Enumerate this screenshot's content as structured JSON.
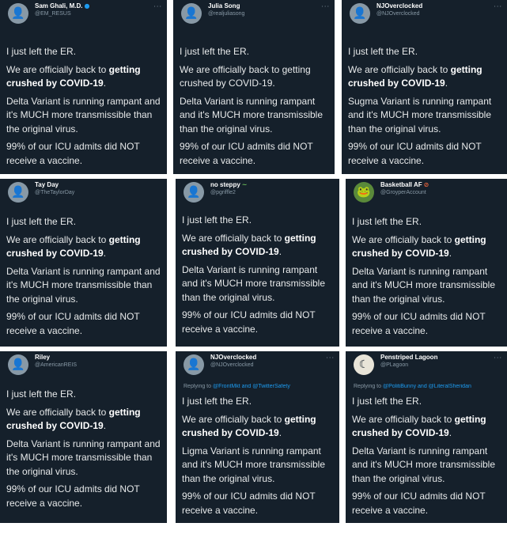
{
  "tweets": [
    {
      "name": "Sam Ghali, M.D.",
      "handle": "@EM_RESUS",
      "badge": "verified-icon",
      "avatar_glyph": "👤",
      "line1": "I just left the ER.",
      "line2_pre": "We are officially back to ",
      "line2_bold1": "getting",
      "line2_bold2": "crushed by COVID-19",
      "line3": "Delta Variant is running rampant and it's MUCH more transmissible than the original virus.",
      "line4": "99% of our ICU admits did NOT receive a vaccine."
    },
    {
      "name": "Julia Song",
      "handle": "@realjuliasong",
      "badge": "",
      "avatar_glyph": "👤",
      "line1": "I just left the ER.",
      "line2_pre": "We are officially back to getting crushed by COVID-19.",
      "line2_bold1": "",
      "line2_bold2": "",
      "line3": "Delta Variant is running rampant and it's MUCH more transmissible than the original virus.",
      "line4": "99% of our ICU admits did NOT receive a vaccine."
    },
    {
      "name": "NJOverclocked",
      "handle": "@NJOverclocked",
      "badge": "",
      "avatar_glyph": "👤",
      "line1": "I just left the ER.",
      "line2_pre": "We are officially back to ",
      "line2_bold1": "getting",
      "line2_bold2": "crushed by COVID-19",
      "line3": "Sugma Variant is running rampant and it's MUCH more transmissible than the original virus.",
      "line4": "99% of our ICU admits did NOT receive a vaccine."
    },
    {
      "name": "Tay Day",
      "handle": "@TheTaylorDay",
      "badge": "",
      "avatar_glyph": "👤",
      "line1": "I just left the ER.",
      "line2_pre": "We are officially back to ",
      "line2_bold1": "getting",
      "line2_bold2": "crushed by COVID-19",
      "line3": "Delta Variant is running rampant and it's MUCH more transmissible than the original virus.",
      "line4": "99% of our ICU admits did NOT receive a vaccine."
    },
    {
      "name": "no steppy",
      "handle": "@pgriffle2",
      "badge": "snake-emoji-icon",
      "avatar_glyph": "👤",
      "line1": "I just left the ER.",
      "line2_pre": "We are officially back to ",
      "line2_bold1": "getting",
      "line2_bold2": "crushed by COVID-19",
      "line3": "Delta Variant is running rampant and it's MUCH more transmissible than the original virus.",
      "line4": "99% of our ICU admits did NOT receive a vaccine."
    },
    {
      "name": "Basketball AF",
      "handle": "@GroyperAccount",
      "badge": "no-entry-icon",
      "avatar_glyph": "🐸",
      "line1": "I just left the ER.",
      "line2_pre": "We are officially back to ",
      "line2_bold1": "getting",
      "line2_bold2": "crushed by COVID-19",
      "line3": "Delta Variant is running rampant and it's MUCH more transmissible than the original virus.",
      "line4": "99% of our ICU admits did NOT receive a vaccine."
    },
    {
      "name": "Riley",
      "handle": "@AmericanREIS",
      "badge": "",
      "avatar_glyph": "👤",
      "line1": "I just left the ER.",
      "line2_pre": "We are officially back to ",
      "line2_bold1": "getting",
      "line2_bold2": "crushed by COVID-19",
      "line3": "Delta Variant is running rampant and it's MUCH more transmissible than the original virus.",
      "line4": "99% of our ICU admits did NOT receive a vaccine."
    },
    {
      "name": "NJOverclocked",
      "handle": "@NJOverclocked",
      "badge": "",
      "avatar_glyph": "👤",
      "replying": "Replying to ",
      "mentions": "@FrontMkt and @TwitterSafety",
      "line1": "I just left the ER.",
      "line2_pre": "We are officially back to ",
      "line2_bold1": "getting",
      "line2_bold2": "crushed by COVID-19",
      "line3": "Ligma Variant is running rampant and it's MUCH more transmissible than the original virus.",
      "line4": "99% of our ICU admits did NOT receive a vaccine."
    },
    {
      "name": "Penstriped Lagoon",
      "handle": "@PLagoon",
      "badge": "",
      "avatar_glyph": "☾",
      "replying": "Replying to ",
      "mentions": "@PolitiBunny and @LiteralSheridan",
      "line1": "I just left the ER.",
      "line2_pre": "We are officially back to ",
      "line2_bold1": "getting",
      "line2_bold2": "crushed by COVID-19",
      "line3": "Delta Variant is running rampant and it's MUCH more transmissible than the original virus.",
      "line4": "99% of our ICU admits did NOT receive a vaccine."
    }
  ],
  "colors": {
    "card_bg": "#15202b",
    "text": "#e7e9ea",
    "muted": "#8899a6",
    "link": "#1d9bf0"
  }
}
